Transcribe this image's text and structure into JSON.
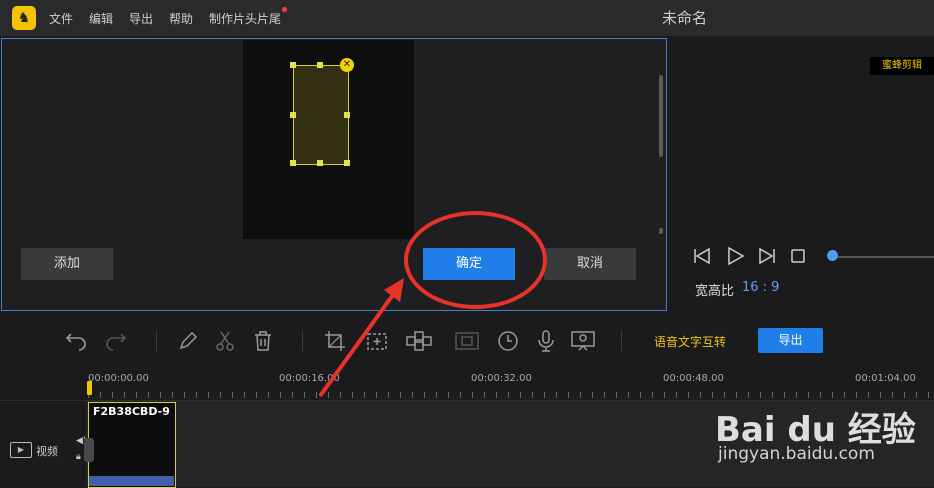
{
  "app": {
    "logo_glyph": "♞",
    "title": "未命名"
  },
  "menu": [
    "文件",
    "编辑",
    "导出",
    "帮助",
    "制作片头片尾"
  ],
  "edit_panel": {
    "add_label": "添加",
    "ok_label": "确定",
    "cancel_label": "取消",
    "close_glyph": "✕"
  },
  "player": {
    "watermark": "蜜蜂剪辑",
    "ratio_label": "宽高比",
    "ratio_value": "16 : 9",
    "controls": [
      "prev-frame-icon",
      "play-icon",
      "next-frame-icon",
      "stop-icon"
    ]
  },
  "toolbar": {
    "tools": [
      "undo-icon",
      "redo-icon",
      "pen-icon",
      "scissors-icon",
      "trash-icon",
      "crop-icon",
      "plus-frame-icon",
      "mosaic-icon",
      "freeze-icon",
      "clock-icon",
      "microphone-icon",
      "screen-record-icon"
    ],
    "speech_text": "语音文字互转",
    "export_label": "导出"
  },
  "timeline": {
    "times": [
      "00:00:00.00",
      "00:00:16.00",
      "00:00:32.00",
      "00:00:48.00",
      "00:01:04.00"
    ],
    "track_label": "视频",
    "clip_name": "F2B38CBD-9"
  },
  "watermark": {
    "brand": "Bai du 经验",
    "url": "jingyan.baidu.com"
  },
  "colors": {
    "accent": "#1f7ee8",
    "highlight": "#f5c400",
    "annotation": "#e8322c"
  }
}
